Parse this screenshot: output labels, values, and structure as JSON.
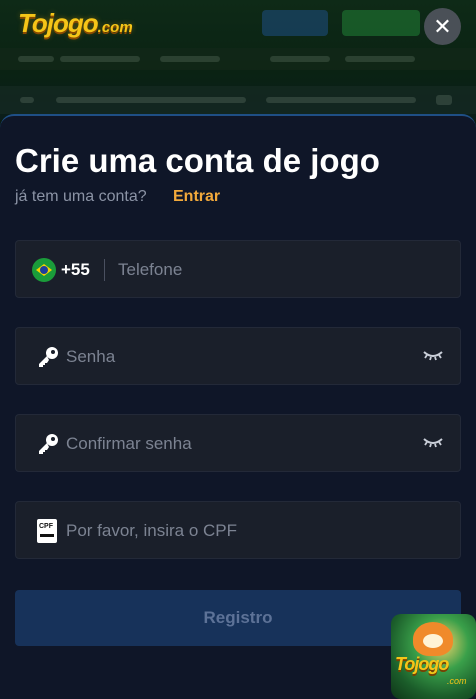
{
  "brand": {
    "name": "Tojogo",
    "suffix": ".com"
  },
  "close_label": "✕",
  "modal": {
    "title": "Crie uma conta de jogo",
    "subtitle": "já tem uma conta?",
    "login_link": "Entrar"
  },
  "form": {
    "phone": {
      "country_code": "+55",
      "placeholder": "Telefone",
      "flag": "brazil-flag-icon"
    },
    "password": {
      "placeholder": "Senha",
      "icon": "key-icon"
    },
    "confirm_password": {
      "placeholder": "Confirmar senha",
      "icon": "key-icon"
    },
    "cpf": {
      "placeholder": "Por favor, insira o CPF",
      "icon_text": "CPF"
    },
    "register_label": "Registro"
  },
  "promo": {
    "logo": "Tojogo",
    "suffix": ".com"
  },
  "colors": {
    "accent": "#f2a93b",
    "modal_bg": "#0f1628",
    "field_bg": "#1a1f2a",
    "button_bg": "#17325a"
  }
}
